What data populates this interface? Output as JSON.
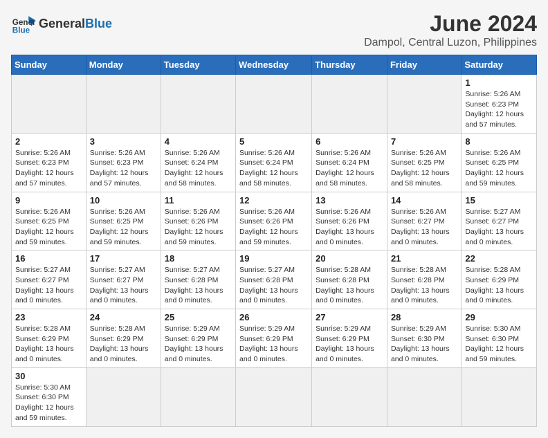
{
  "header": {
    "logo_general": "General",
    "logo_blue": "Blue",
    "month_year": "June 2024",
    "location": "Dampol, Central Luzon, Philippines"
  },
  "weekdays": [
    "Sunday",
    "Monday",
    "Tuesday",
    "Wednesday",
    "Thursday",
    "Friday",
    "Saturday"
  ],
  "weeks": [
    [
      {
        "day": "",
        "info": ""
      },
      {
        "day": "",
        "info": ""
      },
      {
        "day": "",
        "info": ""
      },
      {
        "day": "",
        "info": ""
      },
      {
        "day": "",
        "info": ""
      },
      {
        "day": "",
        "info": ""
      },
      {
        "day": "1",
        "info": "Sunrise: 5:26 AM\nSunset: 6:23 PM\nDaylight: 12 hours\nand 57 minutes."
      }
    ],
    [
      {
        "day": "2",
        "info": "Sunrise: 5:26 AM\nSunset: 6:23 PM\nDaylight: 12 hours\nand 57 minutes."
      },
      {
        "day": "3",
        "info": "Sunrise: 5:26 AM\nSunset: 6:23 PM\nDaylight: 12 hours\nand 57 minutes."
      },
      {
        "day": "4",
        "info": "Sunrise: 5:26 AM\nSunset: 6:24 PM\nDaylight: 12 hours\nand 58 minutes."
      },
      {
        "day": "5",
        "info": "Sunrise: 5:26 AM\nSunset: 6:24 PM\nDaylight: 12 hours\nand 58 minutes."
      },
      {
        "day": "6",
        "info": "Sunrise: 5:26 AM\nSunset: 6:24 PM\nDaylight: 12 hours\nand 58 minutes."
      },
      {
        "day": "7",
        "info": "Sunrise: 5:26 AM\nSunset: 6:25 PM\nDaylight: 12 hours\nand 58 minutes."
      },
      {
        "day": "8",
        "info": "Sunrise: 5:26 AM\nSunset: 6:25 PM\nDaylight: 12 hours\nand 59 minutes."
      }
    ],
    [
      {
        "day": "9",
        "info": "Sunrise: 5:26 AM\nSunset: 6:25 PM\nDaylight: 12 hours\nand 59 minutes."
      },
      {
        "day": "10",
        "info": "Sunrise: 5:26 AM\nSunset: 6:25 PM\nDaylight: 12 hours\nand 59 minutes."
      },
      {
        "day": "11",
        "info": "Sunrise: 5:26 AM\nSunset: 6:26 PM\nDaylight: 12 hours\nand 59 minutes."
      },
      {
        "day": "12",
        "info": "Sunrise: 5:26 AM\nSunset: 6:26 PM\nDaylight: 12 hours\nand 59 minutes."
      },
      {
        "day": "13",
        "info": "Sunrise: 5:26 AM\nSunset: 6:26 PM\nDaylight: 13 hours\nand 0 minutes."
      },
      {
        "day": "14",
        "info": "Sunrise: 5:26 AM\nSunset: 6:27 PM\nDaylight: 13 hours\nand 0 minutes."
      },
      {
        "day": "15",
        "info": "Sunrise: 5:27 AM\nSunset: 6:27 PM\nDaylight: 13 hours\nand 0 minutes."
      }
    ],
    [
      {
        "day": "16",
        "info": "Sunrise: 5:27 AM\nSunset: 6:27 PM\nDaylight: 13 hours\nand 0 minutes."
      },
      {
        "day": "17",
        "info": "Sunrise: 5:27 AM\nSunset: 6:27 PM\nDaylight: 13 hours\nand 0 minutes."
      },
      {
        "day": "18",
        "info": "Sunrise: 5:27 AM\nSunset: 6:28 PM\nDaylight: 13 hours\nand 0 minutes."
      },
      {
        "day": "19",
        "info": "Sunrise: 5:27 AM\nSunset: 6:28 PM\nDaylight: 13 hours\nand 0 minutes."
      },
      {
        "day": "20",
        "info": "Sunrise: 5:28 AM\nSunset: 6:28 PM\nDaylight: 13 hours\nand 0 minutes."
      },
      {
        "day": "21",
        "info": "Sunrise: 5:28 AM\nSunset: 6:28 PM\nDaylight: 13 hours\nand 0 minutes."
      },
      {
        "day": "22",
        "info": "Sunrise: 5:28 AM\nSunset: 6:29 PM\nDaylight: 13 hours\nand 0 minutes."
      }
    ],
    [
      {
        "day": "23",
        "info": "Sunrise: 5:28 AM\nSunset: 6:29 PM\nDaylight: 13 hours\nand 0 minutes."
      },
      {
        "day": "24",
        "info": "Sunrise: 5:28 AM\nSunset: 6:29 PM\nDaylight: 13 hours\nand 0 minutes."
      },
      {
        "day": "25",
        "info": "Sunrise: 5:29 AM\nSunset: 6:29 PM\nDaylight: 13 hours\nand 0 minutes."
      },
      {
        "day": "26",
        "info": "Sunrise: 5:29 AM\nSunset: 6:29 PM\nDaylight: 13 hours\nand 0 minutes."
      },
      {
        "day": "27",
        "info": "Sunrise: 5:29 AM\nSunset: 6:29 PM\nDaylight: 13 hours\nand 0 minutes."
      },
      {
        "day": "28",
        "info": "Sunrise: 5:29 AM\nSunset: 6:30 PM\nDaylight: 13 hours\nand 0 minutes."
      },
      {
        "day": "29",
        "info": "Sunrise: 5:30 AM\nSunset: 6:30 PM\nDaylight: 12 hours\nand 59 minutes."
      }
    ],
    [
      {
        "day": "30",
        "info": "Sunrise: 5:30 AM\nSunset: 6:30 PM\nDaylight: 12 hours\nand 59 minutes."
      },
      {
        "day": "",
        "info": ""
      },
      {
        "day": "",
        "info": ""
      },
      {
        "day": "",
        "info": ""
      },
      {
        "day": "",
        "info": ""
      },
      {
        "day": "",
        "info": ""
      },
      {
        "day": "",
        "info": ""
      }
    ]
  ]
}
